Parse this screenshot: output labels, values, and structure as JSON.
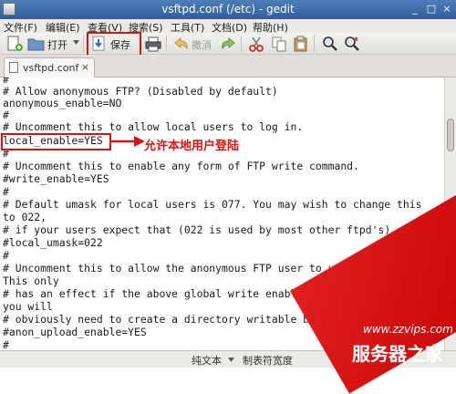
{
  "window": {
    "title": "vsftpd.conf (/etc) - gedit",
    "controls": [
      "_",
      "□",
      "×"
    ]
  },
  "menu": [
    "文件(F)",
    "编辑(E)",
    "查看(V)",
    "搜索(S)",
    "工具(T)",
    "文档(D)",
    "帮助(H)"
  ],
  "toolbar": {
    "open_label": "打开",
    "save_label": "保存",
    "undo_label": "撤消"
  },
  "tab": {
    "label": "vsftpd.conf",
    "close": "×"
  },
  "editor": {
    "lines": [
      "#",
      "# Allow anonymous FTP? (Disabled by default)",
      "anonymous_enable=NO",
      "#",
      "# Uncomment this to allow local users to log in.",
      "local_enable=YES",
      "#",
      "# Uncomment this to enable any form of FTP write command.",
      "#write_enable=YES",
      "#",
      "# Default umask for local users is 077. You may wish to change this",
      "to 022,",
      "# if your users expect that (022 is used by most other ftpd's)",
      "#local_umask=022",
      "#",
      "# Uncomment this to allow the anonymous FTP user to upload files.",
      "This only",
      "# has an effect if the above global write enable is activated. Also,",
      "you will",
      "# obviously need to create a directory writable by the FTP user.",
      "#anon_upload_enable=YES",
      "#"
    ]
  },
  "annotation": {
    "text": "允许本地用户登陆",
    "color": "#dd1111"
  },
  "statusbar": {
    "mode": "纯文本",
    "tab_width": "制表符宽度"
  },
  "watermark": {
    "url": "www.zzvips.com",
    "brand": "服务器之家"
  }
}
